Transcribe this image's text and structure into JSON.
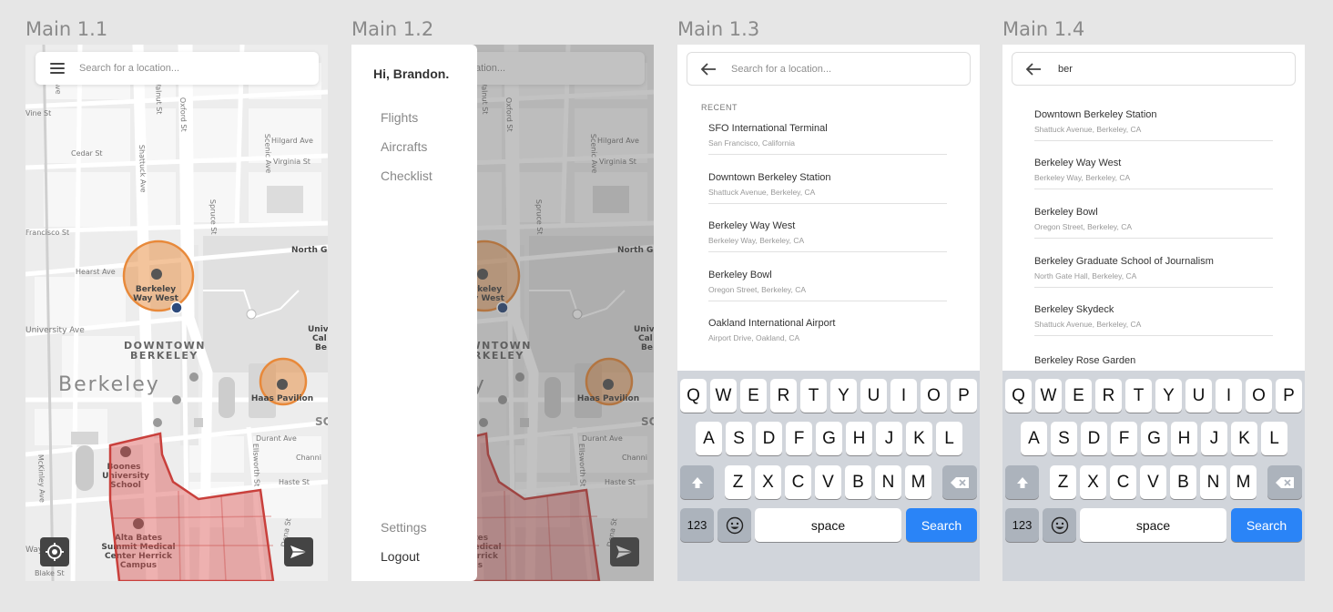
{
  "frames": [
    {
      "title": "Main 1.1"
    },
    {
      "title": "Main 1.2"
    },
    {
      "title": "Main 1.3"
    },
    {
      "title": "Main 1.4"
    }
  ],
  "search": {
    "placeholder": "Search for a location...",
    "typed": "ber"
  },
  "map_labels": {
    "streets": [
      "Vine St",
      "Cedar St",
      "Francisco St",
      "Hearst Ave",
      "University Ave",
      "Walnut St",
      "Oxford St",
      "Shattuck Ave",
      "Spruce St",
      "Hilgard Ave",
      "Virginia St",
      "Scenic Ave",
      "Durant Ave",
      "Channing",
      "Haste St",
      "McKinley Ave",
      "Ellsworth St",
      "Blake St",
      "Dana St"
    ],
    "places": [
      "Berkeley Way West",
      "DOWNTOWN",
      "BERKELEY",
      "Berkeley",
      "Haas Pavilion",
      "Boones University School",
      "Alta Bates Summit Medical Center Herrick Campus",
      "North G",
      "Univ",
      "Cal",
      "Be",
      "SC"
    ]
  },
  "drawer": {
    "greeting": "Hi, Brandon.",
    "items": [
      "Flights",
      "Aircrafts",
      "Checklist"
    ],
    "bottom_items": [
      "Settings",
      "Logout"
    ]
  },
  "recent": {
    "header": "RECENT",
    "items": [
      {
        "title": "SFO International Terminal",
        "sub": "San Francisco, California"
      },
      {
        "title": "Downtown Berkeley Station",
        "sub": "Shattuck Avenue, Berkeley, CA"
      },
      {
        "title": "Berkeley Way West",
        "sub": "Berkeley Way, Berkeley, CA"
      },
      {
        "title": "Berkeley Bowl",
        "sub": "Oregon Street, Berkeley, CA"
      },
      {
        "title": "Oakland International Airport",
        "sub": "Airport Drive, Oakland, CA"
      }
    ]
  },
  "results": {
    "items": [
      {
        "title": "Downtown Berkeley Station",
        "sub": "Shattuck Avenue, Berkeley, CA"
      },
      {
        "title": "Berkeley Way West",
        "sub": "Berkeley Way, Berkeley, CA"
      },
      {
        "title": "Berkeley Bowl",
        "sub": "Oregon Street, Berkeley, CA"
      },
      {
        "title": "Berkeley Graduate School of Journalism",
        "sub": "North Gate Hall, Berkeley, CA"
      },
      {
        "title": "Berkeley Skydeck",
        "sub": "Shattuck Avenue, Berkeley, CA"
      },
      {
        "title": "Berkeley Rose Garden",
        "sub": ""
      }
    ]
  },
  "keyboard": {
    "row1": [
      "Q",
      "W",
      "E",
      "R",
      "T",
      "Y",
      "U",
      "I",
      "O",
      "P"
    ],
    "row2": [
      "A",
      "S",
      "D",
      "F",
      "G",
      "H",
      "J",
      "K",
      "L"
    ],
    "row3": [
      "Z",
      "X",
      "C",
      "V",
      "B",
      "N",
      "M"
    ],
    "numbers": "123",
    "space": "space",
    "action": "Search"
  },
  "colors": {
    "zone": "#d9534f",
    "circle": "#e8893a",
    "location_dot": "#2d4a7c",
    "accent": "#2a84f7"
  }
}
